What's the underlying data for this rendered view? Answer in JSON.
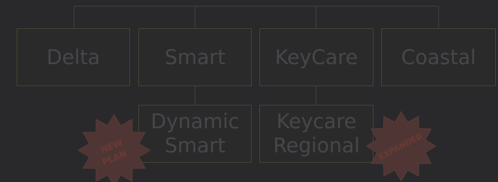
{
  "plans_top": [
    "Delta",
    "Smart",
    "KeyCare",
    "Coastal"
  ],
  "plans_bottom": {
    "dynamic_smart": [
      "Dynamic",
      "Smart"
    ],
    "keycare_regional": [
      "Keycare",
      "Regional"
    ]
  },
  "badges": {
    "new_plan": [
      "NEW",
      "PLAN"
    ],
    "expanded": "EXPANDED"
  },
  "colors": {
    "background": "#29292b",
    "box_border": "#4a4430",
    "text": "#46474a",
    "connector": "#3b3b3e",
    "badge_fill": "#4f3634",
    "badge_text": "#6b3a33"
  }
}
